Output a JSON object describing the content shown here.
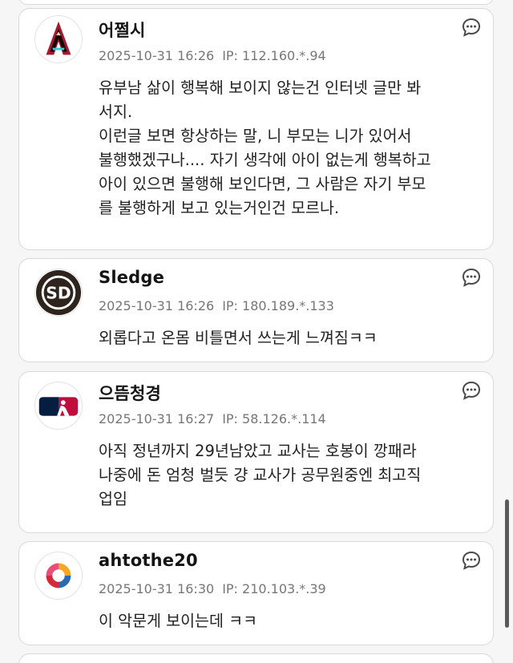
{
  "comments": [
    {
      "author": "어쩔시",
      "avatar_icon": "diamondbacks-logo-icon",
      "date": "2025-10-31 16:26",
      "ip": "IP: 112.160.*.94",
      "body": "유부남 삶이 행복해 보이지 않는건 인터넷 글만 봐서지.\n이런글 보면 항상하는 말, 니 부모는 니가 있어서 불행했겠구나.... 자기 생각에 아이 없는게 행복하고 아이 있으면 불행해 보인다면, 그 사람은 자기 부모를 불행하게 보고 있는거인건 모르나."
    },
    {
      "author": "Sledge",
      "avatar_icon": "padres-logo-icon",
      "date": "2025-10-31 16:26",
      "ip": "IP: 180.189.*.133",
      "body": "외롭다고 온몸 비틀면서 쓰는게 느껴짐ㅋㅋ"
    },
    {
      "author": "으뜸청경",
      "avatar_icon": "mlb-logo-icon",
      "date": "2025-10-31 16:27",
      "ip": "IP: 58.126.*.114",
      "body": "아직 정년까지 29년남았고 교사는 호봉이 깡패라 나중에 돈 엄청 벌듯 걍 교사가 공무원중엔 최고직업임"
    },
    {
      "author": "ahtothe20",
      "avatar_icon": "kbo-logo-icon",
      "date": "2025-10-31 16:30",
      "ip": "IP: 210.103.*.39",
      "body": "이 악문게 보이는데 ㅋㅋ"
    }
  ],
  "icons": {
    "reply": "comment-bubble-icon"
  },
  "colors": {
    "card_border": "#d9d9d9",
    "meta_text": "#777777",
    "background": "#f6f6f6"
  }
}
